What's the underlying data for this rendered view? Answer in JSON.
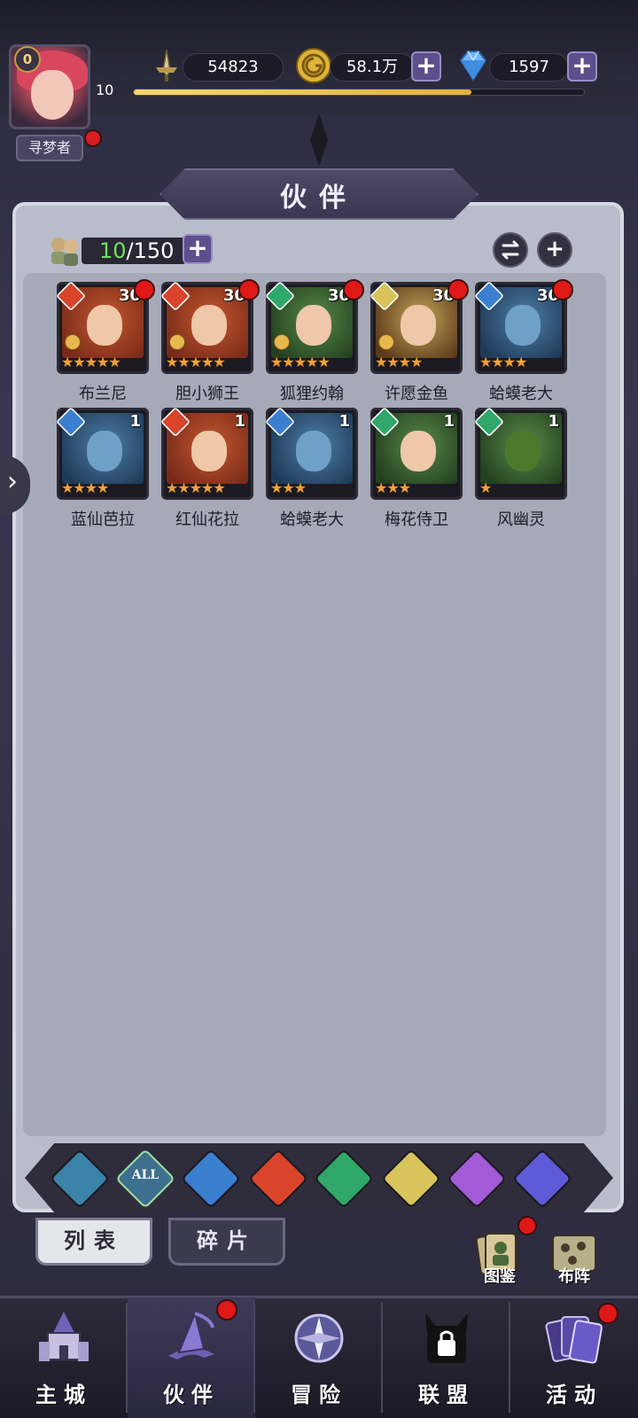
{
  "player": {
    "vip_level": "0",
    "level": "10",
    "name": "寻梦者",
    "xp_fraction": 0.75
  },
  "currencies": {
    "power": "54823",
    "gold": "58.1万",
    "diamonds": "1597"
  },
  "page_title": "伙伴",
  "companion_count": {
    "current": "10",
    "max": "/150"
  },
  "companions": [
    {
      "name": "布兰尼",
      "level": "30",
      "stars": "★★★★★",
      "element": "fire",
      "rank": true,
      "alert": true
    },
    {
      "name": "胆小狮王",
      "level": "30",
      "stars": "★★★★★",
      "element": "fire",
      "rank": true,
      "alert": true
    },
    {
      "name": "狐狸约翰",
      "level": "30",
      "stars": "★★★★★",
      "element": "wind",
      "rank": true,
      "alert": true
    },
    {
      "name": "许愿金鱼",
      "level": "30",
      "stars": "★★★★",
      "element": "light",
      "rank": true,
      "alert": true
    },
    {
      "name": "蛤蟆老大",
      "level": "30",
      "stars": "★★★★",
      "element": "water",
      "rank": false,
      "alert": true
    },
    {
      "name": "蓝仙芭拉",
      "level": "1",
      "stars": "★★★★",
      "element": "water",
      "rank": false,
      "alert": false
    },
    {
      "name": "红仙花拉",
      "level": "1",
      "stars": "★★★★★",
      "element": "fire",
      "rank": false,
      "alert": false
    },
    {
      "name": "蛤蟆老大",
      "level": "1",
      "stars": "★★★",
      "element": "water",
      "rank": false,
      "alert": false
    },
    {
      "name": "梅花侍卫",
      "level": "1",
      "stars": "★★★",
      "element": "wind",
      "rank": false,
      "alert": false
    },
    {
      "name": "风幽灵",
      "level": "1",
      "stars": "★",
      "element": "wind",
      "rank": false,
      "alert": false
    }
  ],
  "filters": [
    {
      "id": "first",
      "label": ""
    },
    {
      "id": "all",
      "label": "ALL"
    },
    {
      "id": "water",
      "label": ""
    },
    {
      "id": "fire",
      "label": ""
    },
    {
      "id": "wind",
      "label": ""
    },
    {
      "id": "light",
      "label": ""
    },
    {
      "id": "dark",
      "label": ""
    },
    {
      "id": "space",
      "label": ""
    }
  ],
  "tabs": {
    "list": "列表",
    "fragments": "碎片"
  },
  "side_buttons": {
    "codex": "图鉴",
    "formation": "布阵"
  },
  "nav": [
    {
      "id": "main-city",
      "label": "主城"
    },
    {
      "id": "companions",
      "label": "伙伴"
    },
    {
      "id": "adventure",
      "label": "冒险"
    },
    {
      "id": "alliance",
      "label": "联盟"
    },
    {
      "id": "events",
      "label": "活动"
    }
  ],
  "colors": {
    "fire": "#d9442a",
    "water": "#3b7fd1",
    "wind": "#2fa86a",
    "light": "#d8c45a",
    "dark": "#a35bd8",
    "space": "#5f5bd8",
    "first": "#3b83a8",
    "all": "#3f6f8f",
    "alert": "#e01818"
  }
}
